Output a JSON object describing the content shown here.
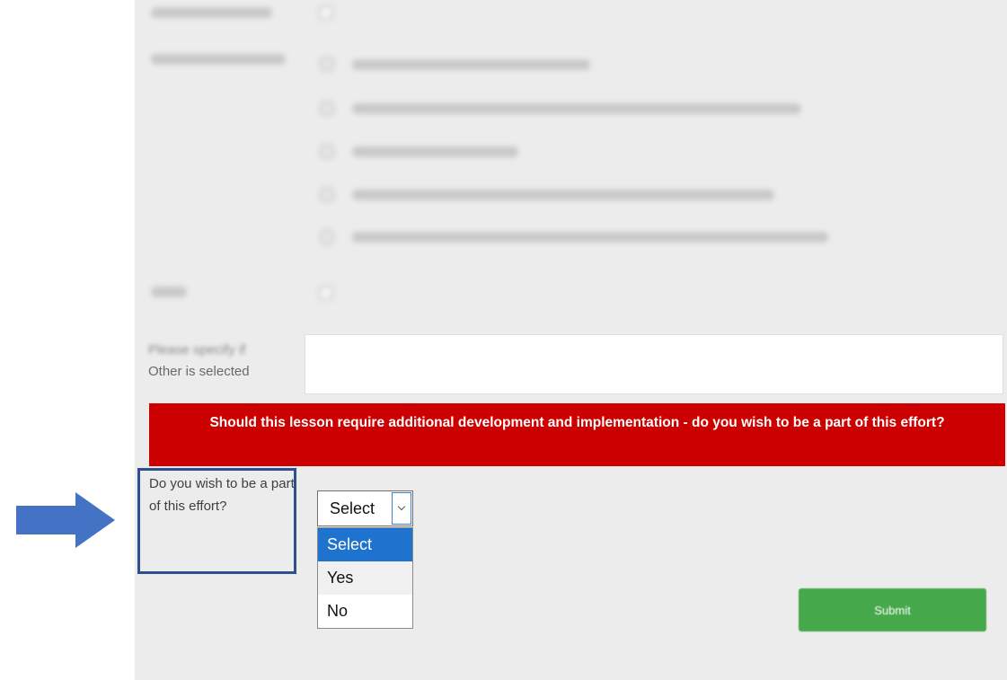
{
  "form": {
    "other_field": {
      "label_line_1": "Please specify if",
      "label_line_2": "Other is selected",
      "value": ""
    },
    "banner_text": "Should this lesson require additional development and implementation - do you wish to be a part of this effort?",
    "participation": {
      "label": "Do you wish to be a part of this effort?",
      "selected": "Select",
      "options": [
        "Select",
        "Yes",
        "No"
      ]
    },
    "submit_label": "Submit"
  },
  "colors": {
    "banner": "#cc0000",
    "submit": "#45a84a",
    "highlight_box": "#2f4f8f",
    "arrow": "#4472c4",
    "selected_option": "#1e73cf"
  }
}
